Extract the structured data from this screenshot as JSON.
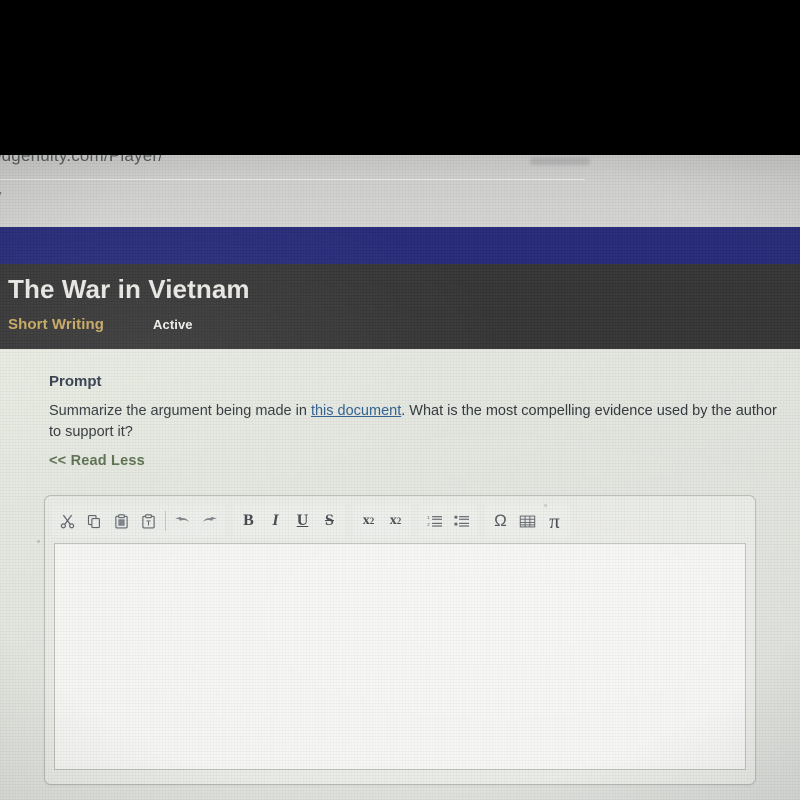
{
  "browser": {
    "url_text": "edgenuity.com/Player/",
    "tab_sliver_text": "y"
  },
  "activity": {
    "title": "The War in Vietnam",
    "type_label": "Short Writing",
    "status_label": "Active"
  },
  "prompt": {
    "heading": "Prompt",
    "text_before_link": "Summarize the argument being made in ",
    "link_label": "this document",
    "text_after_link": ". What is the most compelling evidence used by the author to support it?",
    "read_less_label": "<< Read Less"
  },
  "editor": {
    "textarea_value": "",
    "textarea_placeholder": "",
    "toolbar_groups": [
      {
        "name": "clipboard",
        "buttons": [
          {
            "name": "cut-icon",
            "label": "Cut"
          },
          {
            "name": "copy-icon",
            "label": "Copy"
          },
          {
            "name": "paste-icon",
            "label": "Paste"
          },
          {
            "name": "paste-as-text-icon",
            "label": "Paste as plain text"
          },
          {
            "name": "undo-icon",
            "label": "Undo"
          },
          {
            "name": "redo-icon",
            "label": "Redo"
          }
        ]
      },
      {
        "name": "text-format",
        "buttons": [
          {
            "name": "bold-button",
            "label": "B"
          },
          {
            "name": "italic-button",
            "label": "I"
          },
          {
            "name": "underline-button",
            "label": "U"
          },
          {
            "name": "strikethrough-button",
            "label": "S"
          }
        ]
      },
      {
        "name": "script-format",
        "buttons": [
          {
            "name": "subscript-button",
            "label": "x"
          },
          {
            "name": "superscript-button",
            "label": "x"
          }
        ]
      },
      {
        "name": "lists",
        "buttons": [
          {
            "name": "numbered-list-icon",
            "label": "Insert/Remove Numbered List"
          },
          {
            "name": "bulleted-list-icon",
            "label": "Insert/Remove Bulleted List"
          }
        ]
      },
      {
        "name": "insert",
        "buttons": [
          {
            "name": "special-character-icon",
            "label": "Ω"
          },
          {
            "name": "table-icon",
            "label": "Table"
          },
          {
            "name": "math-icon",
            "label": "π"
          }
        ]
      }
    ]
  },
  "colors": {
    "navy_band": "#262a78",
    "header_dark": "#343434",
    "activity_type_gold": "#c9a961",
    "link_blue": "#2c5e8f",
    "read_less_green": "#5c7050",
    "content_bg": "#e3e6df",
    "textarea_bg": "#f6f6f4"
  }
}
